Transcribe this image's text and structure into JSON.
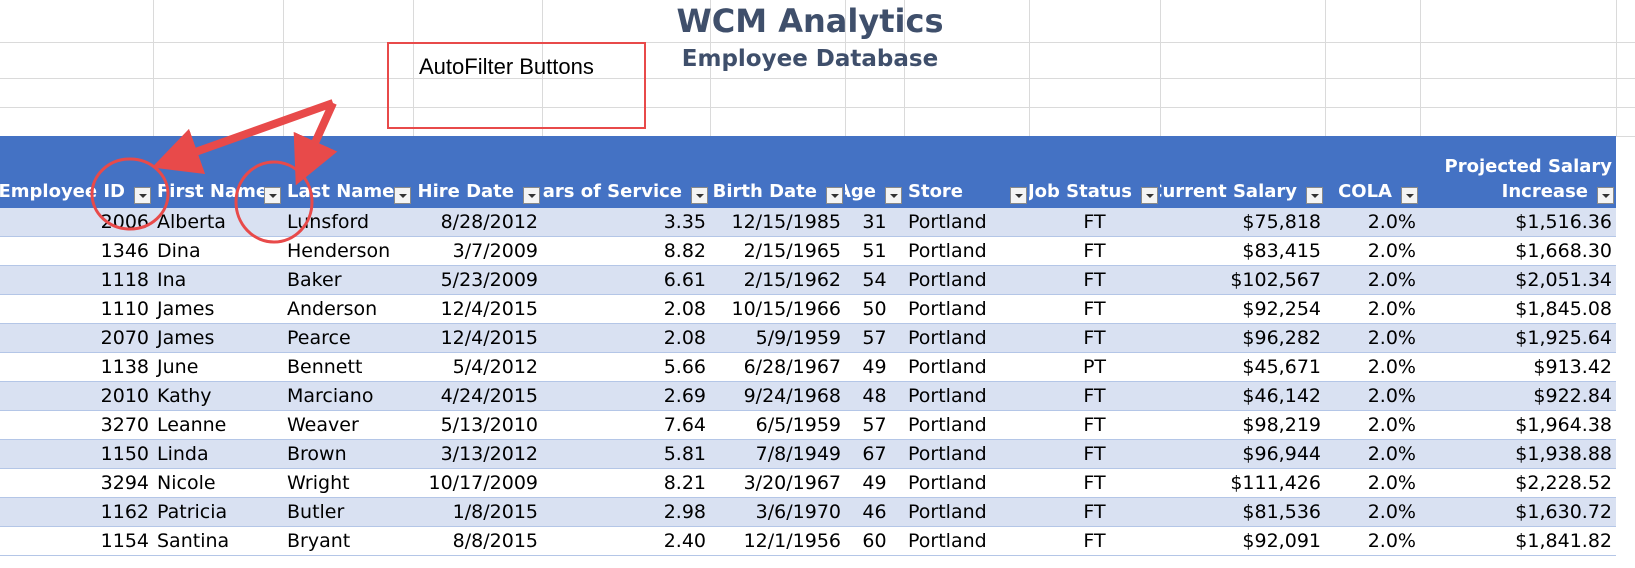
{
  "title": "WCM Analytics",
  "subtitle": "Employee Database",
  "callout": "AutoFilter Buttons",
  "columns": [
    {
      "label": "Employee ID",
      "align": "right"
    },
    {
      "label": "First Name",
      "align": "left"
    },
    {
      "label": "Last Name",
      "align": "left"
    },
    {
      "label": "Hire Date",
      "align": "right"
    },
    {
      "label": "Years of Service",
      "align": "right"
    },
    {
      "label": "Birth Date",
      "align": "right"
    },
    {
      "label": "Age",
      "align": "center"
    },
    {
      "label": "Store",
      "align": "left"
    },
    {
      "label": "Job Status",
      "align": "center"
    },
    {
      "label": "Current Salary",
      "align": "right"
    },
    {
      "label": "COLA",
      "align": "right"
    },
    {
      "label": "Projected Salary Increase",
      "line1": "Projected Salary",
      "line2": "Increase",
      "align": "right"
    }
  ],
  "filter_icon": "dropdown-arrow-icon",
  "colors": {
    "header_bg": "#4472c4",
    "band_row": "#d9e1f2",
    "title": "#3f4f6b",
    "annotation_red": "#e84a4a"
  },
  "rows": [
    [
      "2006",
      "Alberta",
      "Lunsford",
      "8/28/2012",
      "3.35",
      "12/15/1985",
      "31",
      "Portland",
      "FT",
      "$75,818",
      "2.0%",
      "$1,516.36"
    ],
    [
      "1346",
      "Dina",
      "Henderson",
      "3/7/2009",
      "8.82",
      "2/15/1965",
      "51",
      "Portland",
      "FT",
      "$83,415",
      "2.0%",
      "$1,668.30"
    ],
    [
      "1118",
      "Ina",
      "Baker",
      "5/23/2009",
      "6.61",
      "2/15/1962",
      "54",
      "Portland",
      "FT",
      "$102,567",
      "2.0%",
      "$2,051.34"
    ],
    [
      "1110",
      "James",
      "Anderson",
      "12/4/2015",
      "2.08",
      "10/15/1966",
      "50",
      "Portland",
      "FT",
      "$92,254",
      "2.0%",
      "$1,845.08"
    ],
    [
      "2070",
      "James",
      "Pearce",
      "12/4/2015",
      "2.08",
      "5/9/1959",
      "57",
      "Portland",
      "FT",
      "$96,282",
      "2.0%",
      "$1,925.64"
    ],
    [
      "1138",
      "June",
      "Bennett",
      "5/4/2012",
      "5.66",
      "6/28/1967",
      "49",
      "Portland",
      "PT",
      "$45,671",
      "2.0%",
      "$913.42"
    ],
    [
      "2010",
      "Kathy",
      "Marciano",
      "4/24/2015",
      "2.69",
      "9/24/1968",
      "48",
      "Portland",
      "FT",
      "$46,142",
      "2.0%",
      "$922.84"
    ],
    [
      "3270",
      "Leanne",
      "Weaver",
      "5/13/2010",
      "7.64",
      "6/5/1959",
      "57",
      "Portland",
      "FT",
      "$98,219",
      "2.0%",
      "$1,964.38"
    ],
    [
      "1150",
      "Linda",
      "Brown",
      "3/13/2012",
      "5.81",
      "7/8/1949",
      "67",
      "Portland",
      "FT",
      "$96,944",
      "2.0%",
      "$1,938.88"
    ],
    [
      "3294",
      "Nicole",
      "Wright",
      "10/17/2009",
      "8.21",
      "3/20/1967",
      "49",
      "Portland",
      "FT",
      "$111,426",
      "2.0%",
      "$2,228.52"
    ],
    [
      "1162",
      "Patricia",
      "Butler",
      "1/8/2015",
      "2.98",
      "3/6/1970",
      "46",
      "Portland",
      "FT",
      "$81,536",
      "2.0%",
      "$1,630.72"
    ],
    [
      "1154",
      "Santina",
      "Bryant",
      "8/8/2015",
      "2.40",
      "12/1/1956",
      "60",
      "Portland",
      "FT",
      "$92,091",
      "2.0%",
      "$1,841.82"
    ]
  ]
}
